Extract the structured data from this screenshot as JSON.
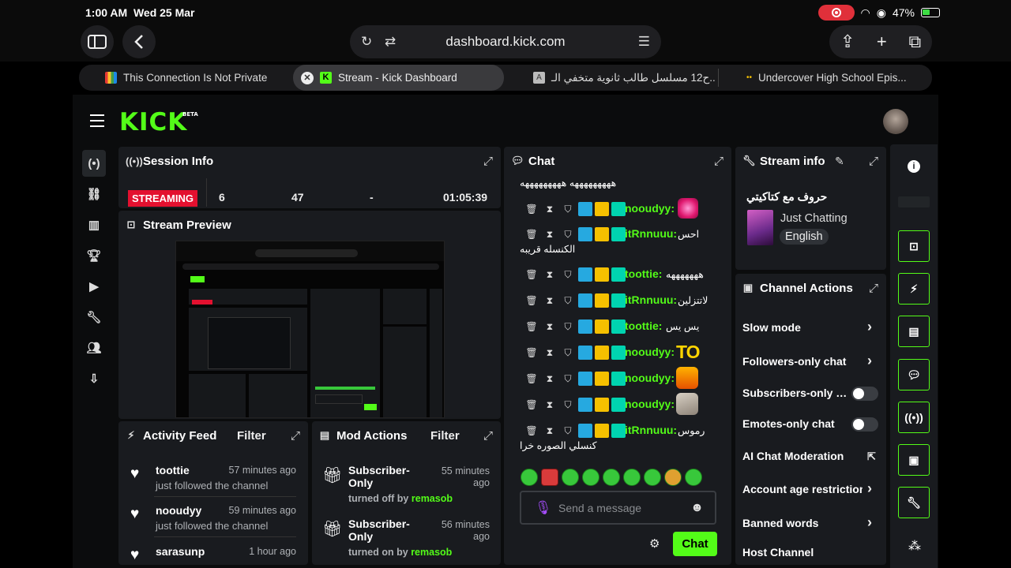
{
  "status_bar": {
    "time": "1:00 AM",
    "date": "Wed 25 Mar",
    "battery": "47%"
  },
  "browser": {
    "url": "dashboard.kick.com",
    "tabs": [
      {
        "title": "This Connection Is Not Private",
        "active": false
      },
      {
        "title": "Stream - Kick Dashboard",
        "active": true
      },
      {
        "title": "ح12 مسلسل طالب ثانوية متخفي الـ...",
        "active": false
      },
      {
        "title": "Undercover High School Epis...",
        "active": false
      }
    ]
  },
  "header": {
    "logo": "KICK",
    "logo_badge": "BETA"
  },
  "session_info": {
    "title": "Session Info",
    "status": "STREAMING",
    "viewers": "6",
    "followers": "47",
    "subs": "-",
    "duration": "01:05:39"
  },
  "stream_preview": {
    "title": "Stream Preview"
  },
  "activity_feed": {
    "title": "Activity Feed",
    "filter_label": "Filter",
    "items": [
      {
        "user": "toottie",
        "action": "just followed the channel",
        "time": "57 minutes ago"
      },
      {
        "user": "nooudyy",
        "action": "just followed the channel",
        "time": "59 minutes ago"
      },
      {
        "user": "sarasunp",
        "action": "",
        "time": "1 hour ago"
      }
    ]
  },
  "mod_actions": {
    "title": "Mod Actions",
    "filter_label": "Filter",
    "items": [
      {
        "title": "Subscriber-Only",
        "time": "55 minutes ago",
        "action": "turned off by",
        "by": "remasob"
      },
      {
        "title": "Subscriber-Only",
        "time": "56 minutes ago",
        "action": "turned on by",
        "by": "remasob"
      }
    ]
  },
  "chat": {
    "title": "Chat",
    "top_cut_message": "هههههههههه هههههههههه",
    "messages": [
      {
        "user": "nooudyy:",
        "text": ""
      },
      {
        "user": "itRnnuuu:",
        "text": "احس",
        "line2": "الكنسله قريبه"
      },
      {
        "user": "toottie:",
        "text": "هههههههه"
      },
      {
        "user": "itRnnuuu:",
        "text": "لاتتزلين"
      },
      {
        "user": "toottie:",
        "text": "يس يس"
      },
      {
        "user": "nooudyy:",
        "text": "TO"
      },
      {
        "user": "nooudyy:",
        "text": ""
      },
      {
        "user": "nooudyy:",
        "text": ""
      },
      {
        "user": "itRnnuuu:",
        "text": "رموس",
        "line2": "كنسلي الصوره خرا"
      }
    ],
    "input_placeholder": "Send a message",
    "send_label": "Chat"
  },
  "stream_info": {
    "title": "Stream info",
    "stream_title": "حروف مع كتاكيتي",
    "category": "Just Chatting",
    "language": "English"
  },
  "channel_actions": {
    "title": "Channel Actions",
    "items": [
      {
        "label": "Slow mode",
        "control": "arrow"
      },
      {
        "label": "Followers-only chat",
        "control": "arrow"
      },
      {
        "label": "Subscribers-only chat",
        "control": "toggle"
      },
      {
        "label": "Emotes-only chat",
        "control": "toggle"
      },
      {
        "label": "AI Chat Moderation",
        "control": "external"
      },
      {
        "label": "Account age restriction",
        "control": "arrow"
      },
      {
        "label": "Banned words",
        "control": "arrow"
      },
      {
        "label": "Host Channel",
        "control": "none"
      }
    ]
  },
  "colors": {
    "brand": "#53fc18",
    "streaming": "#e3102f",
    "panel": "#191b1f",
    "background": "#0b0c0d"
  }
}
